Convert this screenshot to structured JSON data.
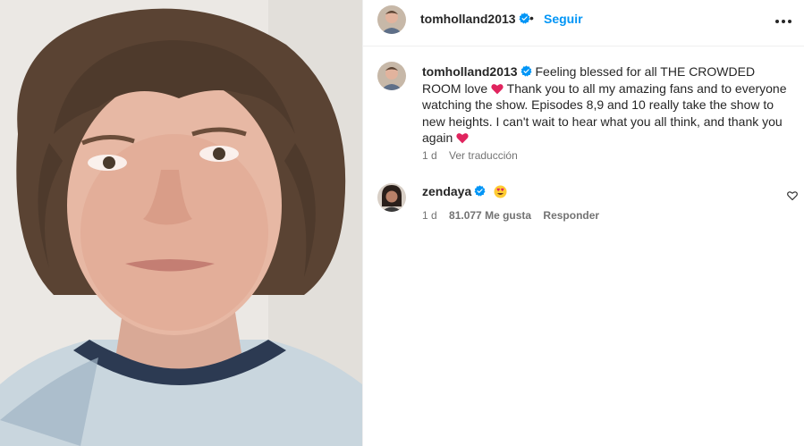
{
  "post": {
    "author": "tomholland2013",
    "follow_label": "Seguir",
    "separator": "•",
    "more_icon": "more-horizontal-icon"
  },
  "caption": {
    "username": "tomholland2013",
    "text_part1": "Feeling blessed for all THE CROWDED ROOM love",
    "text_part2": "Thank you to all my amazing fans and to everyone watching the show. Episodes 8,9 and 10 really take the show to new heights. I can't wait to hear what you all think, and thank you again",
    "emoji": "red-heart",
    "time": "1 d",
    "translate_label": "Ver traducción"
  },
  "comment": {
    "username": "zendaya",
    "emoji": "smiling-face-with-heart-eyes",
    "time": "1 d",
    "likes_label": "81.077 Me gusta",
    "reply_label": "Responder",
    "like_icon": "heart-outline-icon"
  },
  "colors": {
    "link_blue": "#0095f6",
    "verified_blue": "#0095f6",
    "secondary_text": "#737373",
    "heart_red": "#e0245e"
  }
}
